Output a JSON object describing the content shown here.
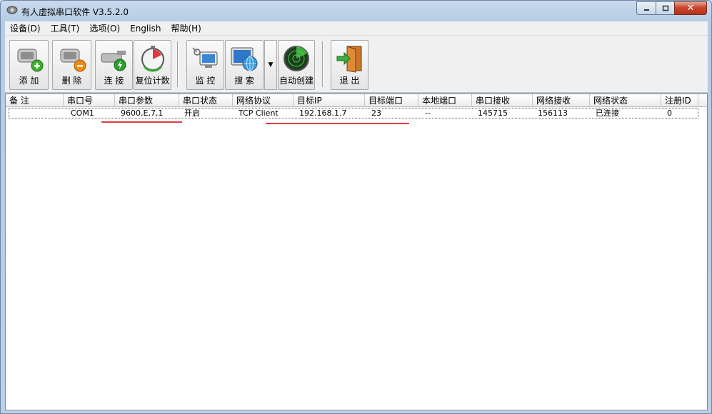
{
  "window": {
    "title": "有人虚拟串口软件 V3.5.2.0"
  },
  "menu": [
    "设备(D)",
    "工具(T)",
    "选项(O)",
    "English",
    "帮助(H)"
  ],
  "toolbar": {
    "add": "添 加",
    "delete": "删 除",
    "connect": "连 接",
    "reset": "复位计数",
    "monitor": "监 控",
    "search": "搜 索",
    "autocreate": "自动创建",
    "exit": "退 出"
  },
  "columns": [
    "备 注",
    "串口号",
    "串口参数",
    "串口状态",
    "网络协议",
    "目标IP",
    "目标端口",
    "本地端口",
    "串口接收",
    "网络接收",
    "网络状态",
    "注册ID"
  ],
  "rows": [
    {
      "note": "",
      "port": "COM1",
      "params": "9600,E,7,1",
      "port_status": "开启",
      "protocol": "TCP Client",
      "target_ip": "192.168.1.7",
      "target_port": "23",
      "local_port": "--",
      "serial_rx": "145715",
      "net_rx": "156113",
      "net_status": "已连接",
      "reg_id": "0"
    }
  ],
  "colors": {
    "highlight_underline": "#e03c3c",
    "close_button": "#c9462c"
  }
}
